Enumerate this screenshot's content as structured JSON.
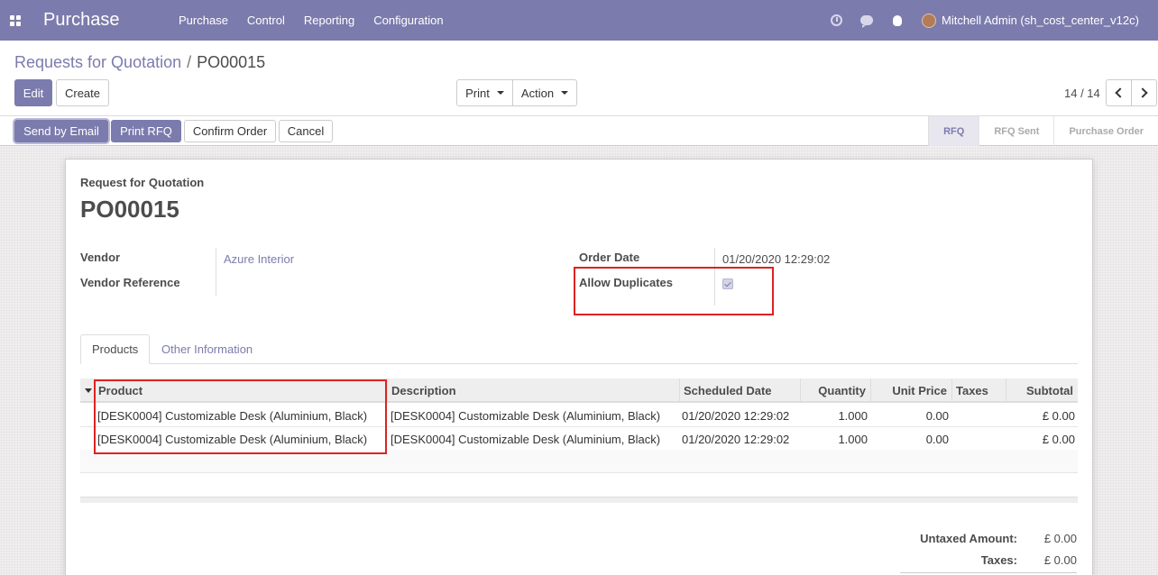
{
  "navbar": {
    "brand": "Purchase",
    "menu": [
      "Purchase",
      "Control",
      "Reporting",
      "Configuration"
    ],
    "user": "Mitchell Admin (sh_cost_center_v12c)"
  },
  "control": {
    "breadcrumb_parent": "Requests for Quotation",
    "breadcrumb_sep": "/",
    "breadcrumb_current": "PO00015",
    "edit_label": "Edit",
    "create_label": "Create",
    "print_label": "Print",
    "action_label": "Action",
    "pager": "14 / 14"
  },
  "statusbar": {
    "send_email": "Send by Email",
    "print_rfq": "Print RFQ",
    "confirm": "Confirm Order",
    "cancel": "Cancel",
    "stages": [
      "RFQ",
      "RFQ Sent",
      "Purchase Order"
    ]
  },
  "form": {
    "doc_type": "Request for Quotation",
    "doc_name": "PO00015",
    "vendor_label": "Vendor",
    "vendor_value": "Azure Interior",
    "vendor_ref_label": "Vendor Reference",
    "order_date_label": "Order Date",
    "order_date_value": "01/20/2020 12:29:02",
    "allow_dup_label": "Allow Duplicates",
    "allow_dup_checked": true
  },
  "tabs": [
    "Products",
    "Other Information"
  ],
  "table": {
    "headers": [
      "Product",
      "Description",
      "Scheduled Date",
      "Quantity",
      "Unit Price",
      "Taxes",
      "Subtotal"
    ],
    "rows": [
      [
        "[DESK0004] Customizable Desk (Aluminium, Black)",
        "[DESK0004] Customizable Desk (Aluminium, Black)",
        "01/20/2020 12:29:02",
        "1.000",
        "0.00",
        "",
        "£ 0.00"
      ],
      [
        "[DESK0004] Customizable Desk (Aluminium, Black)",
        "[DESK0004] Customizable Desk (Aluminium, Black)",
        "01/20/2020 12:29:02",
        "1.000",
        "0.00",
        "",
        "£ 0.00"
      ]
    ]
  },
  "totals": {
    "untaxed_label": "Untaxed Amount:",
    "untaxed_value": "£ 0.00",
    "taxes_label": "Taxes:",
    "taxes_value": "£ 0.00"
  }
}
